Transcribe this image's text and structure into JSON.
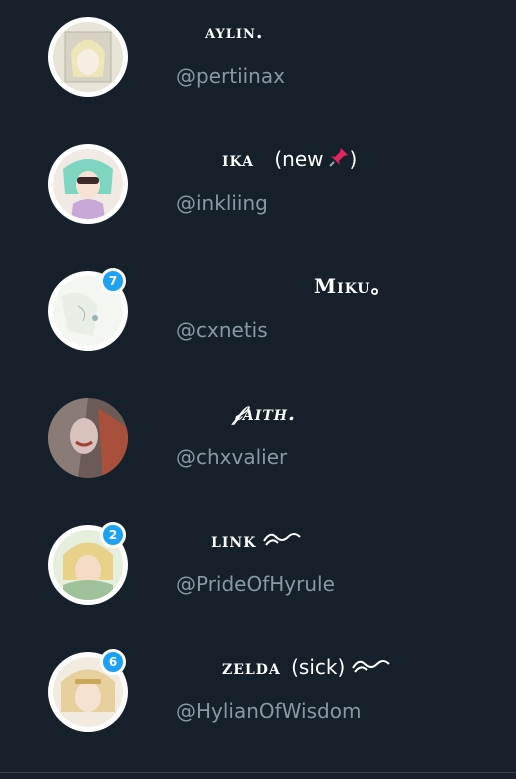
{
  "contacts": [
    {
      "display_name": "aylin.",
      "handle": "@pertiinax",
      "badge": "",
      "suffix": "",
      "icon": ""
    },
    {
      "display_name": "ika",
      "handle": "@inkliing",
      "badge": "",
      "suffix": "(new",
      "suffix_end": ")",
      "icon": "pushpin-icon"
    },
    {
      "display_name": "Miku。",
      "handle": "@cxnetis",
      "badge": "7",
      "suffix": "",
      "icon": ""
    },
    {
      "display_name": "𝒻aith.",
      "handle": "@chxvalier",
      "badge": "",
      "suffix": "",
      "icon": ""
    },
    {
      "display_name": "link",
      "handle": "@PrideOfHyrule",
      "badge": "2",
      "suffix": "",
      "icon": "wave-icon"
    },
    {
      "display_name": "zelda",
      "handle": "@HylianOfWisdom",
      "badge": "6",
      "suffix": "(sick)",
      "icon": "wave-icon"
    }
  ],
  "colors": {
    "background": "#15202b",
    "handle": "#8899a6",
    "badge": "#1da1f2"
  }
}
